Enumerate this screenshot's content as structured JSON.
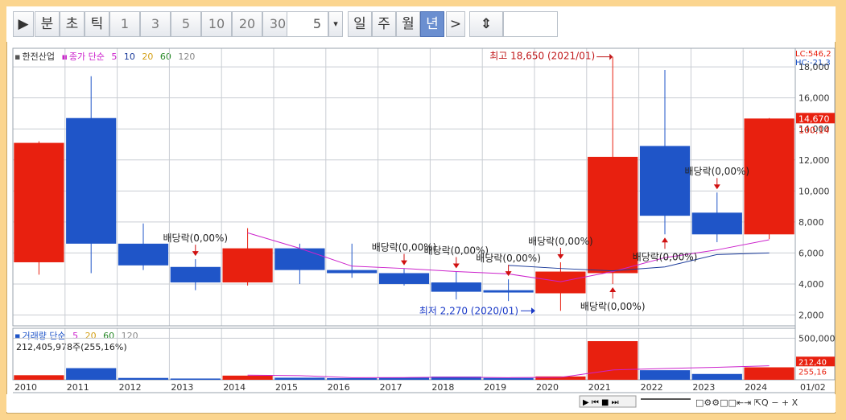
{
  "toolbar": {
    "play_label": "▶",
    "minute": "분",
    "second": "초",
    "tick": "틱",
    "n1": "1",
    "n3": "3",
    "n5": "5",
    "n10": "10",
    "n20": "20",
    "n30": "30",
    "period_value": "5",
    "dropdown_glyph": "▾",
    "day": "일",
    "week": "주",
    "month": "월",
    "year": "년",
    "next_glyph": ">",
    "resize_glyph": "⇕"
  },
  "price_legend": {
    "stock_name": "한전산업",
    "ma_label": "종가 단순",
    "p5": "5",
    "p10": "10",
    "p20": "20",
    "p60": "60",
    "p120": "120",
    "lc": "LC:546,2",
    "hc": "HC:-21,3"
  },
  "volume_legend": {
    "label": "거래량 단순",
    "p5": "5",
    "p20": "20",
    "p60": "60",
    "p120": "120",
    "value": "212,405,978주(255,16%)"
  },
  "colors": {
    "up": "#e8200f",
    "down": "#1f55c8",
    "ma5": "#cc22cc",
    "ma10": "#1a3a9a",
    "ma20": "#d4a017",
    "ma60": "#2a8a2a",
    "ma120": "#888888",
    "grid": "#c9cdd3"
  },
  "chart_data": {
    "type": "candlestick",
    "x": [
      "2010",
      "2011",
      "2012",
      "2013",
      "2014",
      "2015",
      "2016",
      "2017",
      "2018",
      "2019",
      "2020",
      "2021",
      "2022",
      "2023",
      "2024"
    ],
    "x_extra_label": "01/02",
    "candles": [
      {
        "year": "2010",
        "open": 5400,
        "high": 13200,
        "low": 4600,
        "close": 13100
      },
      {
        "year": "2011",
        "open": 14700,
        "high": 17400,
        "low": 4700,
        "close": 6600
      },
      {
        "year": "2012",
        "open": 6600,
        "high": 7900,
        "low": 4900,
        "close": 5200
      },
      {
        "year": "2013",
        "open": 5100,
        "high": 5600,
        "low": 3600,
        "close": 4100
      },
      {
        "year": "2014",
        "open": 4100,
        "high": 7600,
        "low": 3900,
        "close": 6300
      },
      {
        "year": "2015",
        "open": 6300,
        "high": 6600,
        "low": 4000,
        "close": 4900
      },
      {
        "year": "2016",
        "open": 4900,
        "high": 6600,
        "low": 4400,
        "close": 4700
      },
      {
        "year": "2017",
        "open": 4700,
        "high": 5000,
        "low": 3900,
        "close": 4000
      },
      {
        "year": "2018",
        "open": 4100,
        "high": 4800,
        "low": 3000,
        "close": 3500
      },
      {
        "year": "2019",
        "open": 3600,
        "high": 4300,
        "low": 2900,
        "close": 3450
      },
      {
        "year": "2020",
        "open": 3400,
        "high": 5400,
        "low": 2270,
        "close": 4800
      },
      {
        "year": "2021",
        "open": 4700,
        "high": 18650,
        "low": 4000,
        "close": 12200
      },
      {
        "year": "2022",
        "open": 12900,
        "high": 17800,
        "low": 7200,
        "close": 8400
      },
      {
        "year": "2023",
        "open": 8600,
        "high": 9900,
        "low": 6700,
        "close": 7200
      },
      {
        "year": "2024",
        "open": 7200,
        "high": 14700,
        "low": 6900,
        "close": 14670
      }
    ],
    "ma5": [
      null,
      null,
      null,
      null,
      7300,
      6300,
      5150,
      5000,
      4800,
      4650,
      4150,
      4800,
      5700,
      6200,
      6850
    ],
    "ma10": [
      null,
      null,
      null,
      null,
      null,
      null,
      null,
      null,
      null,
      5200,
      5000,
      4850,
      5100,
      5900,
      6000
    ],
    "y_ticks": [
      2000,
      4000,
      6000,
      8000,
      10000,
      12000,
      14000,
      16000,
      18000
    ],
    "y_tick_labels": [
      "2,000",
      "4,000",
      "6,000",
      "8,000",
      "10,000",
      "12,000",
      "14,000",
      "16,000",
      "18,000"
    ],
    "ylim": [
      1300,
      19200
    ],
    "current_price_label": "14,670",
    "current_ma_label": "100,14",
    "annotations": {
      "high": "최고 18,650 (2021/01)",
      "low": "최저 2,270 (2020/01)",
      "dividend": "배당락(0,00%)"
    },
    "dividend_marks": [
      {
        "year": "2013",
        "dir": "down",
        "label_year_offset": 0
      },
      {
        "year": "2017",
        "dir": "down"
      },
      {
        "year": "2018",
        "dir": "down"
      },
      {
        "year": "2019",
        "dir": "down"
      },
      {
        "year": "2020",
        "dir": "down"
      },
      {
        "year": "2021",
        "dir": "up"
      },
      {
        "year": "2022",
        "dir": "up"
      },
      {
        "year": "2023",
        "dir": "down"
      }
    ],
    "volume": {
      "values": [
        55000000,
        140000000,
        22000000,
        15000000,
        50000000,
        25000000,
        20000000,
        25000000,
        38000000,
        22000000,
        40000000,
        465000000,
        115000000,
        70000000,
        150000000
      ],
      "ma": [
        null,
        null,
        null,
        null,
        56000000,
        50000000,
        26000000,
        27000000,
        31000000,
        26000000,
        29000000,
        118000000,
        136000000,
        150000000,
        168000000
      ],
      "ylim": [
        0,
        620000000
      ],
      "y_tick_label": "500,000",
      "current_label_1": "212,40",
      "current_label_2": "255,16"
    }
  }
}
